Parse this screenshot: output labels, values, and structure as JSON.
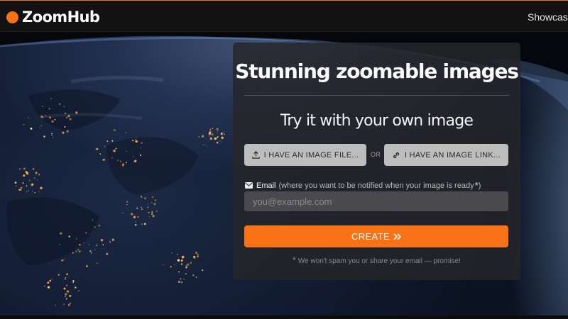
{
  "header": {
    "logo_text": "ZoomHub",
    "nav_link": "Showcase"
  },
  "hero": {
    "background": "earth-at-night-from-space"
  },
  "card": {
    "title": "Stunning zoomable images",
    "subtitle": "Try it with your own image",
    "file_button_label": "I HAVE AN IMAGE FILE...",
    "file_button_icon": "upload-icon",
    "or_label": "OR",
    "link_button_label": "I HAVE AN IMAGE LINK...",
    "link_button_icon": "link-icon",
    "email_icon": "envelope-icon",
    "email_label": "Email",
    "email_hint": "(where you want to be notified when your image is ready",
    "email_hint_close": ")",
    "required_mark": "*",
    "email_placeholder": "you@example.com",
    "email_value": "",
    "create_button_label": "CREATE",
    "create_button_icon": "double-chevron-right-icon",
    "spam_note": "We won't spam you or share your email — promise!"
  },
  "colors": {
    "accent": "#f97316",
    "card_bg": "#26262a",
    "button_gray": "#bdbdbd",
    "topbar": "#121212"
  }
}
